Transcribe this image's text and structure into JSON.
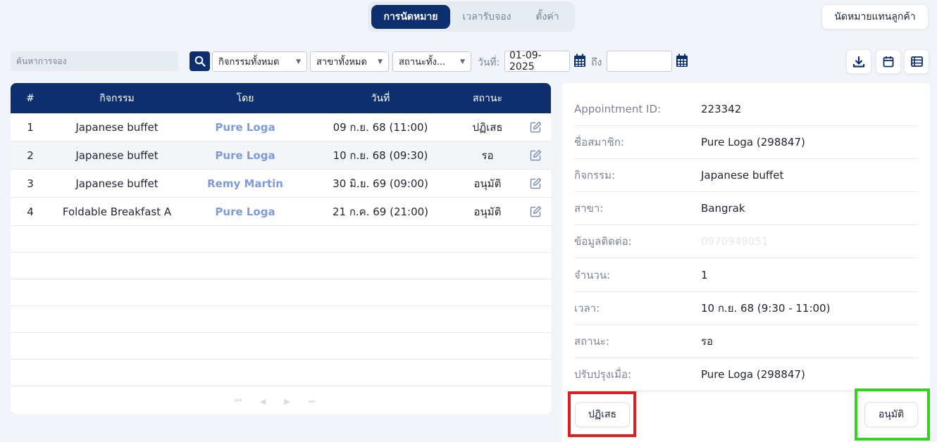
{
  "tabs": [
    {
      "label": "การนัดหมาย",
      "active": true
    },
    {
      "label": "เวลารับจอง",
      "active": false
    },
    {
      "label": "ตั้งค่า",
      "active": false
    }
  ],
  "proxy_button_label": "นัดหมายแทนลูกค้า",
  "filters": {
    "search_placeholder": "ค้นหาการจอง",
    "activity_select": "กิจกรรมทั้งหมด",
    "branch_select": "สาขาทั้งหมด",
    "status_select": "สถานะทั้ง...",
    "date_label": "วันที่:",
    "date_from": "01-09-2025",
    "to_label": "ถึง",
    "date_to": ""
  },
  "table": {
    "headers": [
      "#",
      "กิจกรรม",
      "โดย",
      "วันที่",
      "สถานะ"
    ],
    "rows": [
      {
        "idx": "1",
        "activity": "Japanese buffet",
        "by": "Pure Loga",
        "date": "09 ก.ย. 68 (11:00)",
        "status": "ปฏิเสธ"
      },
      {
        "idx": "2",
        "activity": "Japanese buffet",
        "by": "Pure Loga",
        "date": "10 ก.ย. 68 (09:30)",
        "status": "รอ"
      },
      {
        "idx": "3",
        "activity": "Japanese buffet",
        "by": "Remy Martin",
        "date": "30 มิ.ย. 69 (09:00)",
        "status": "อนุมัติ"
      },
      {
        "idx": "4",
        "activity": "Foldable Breakfast A",
        "by": "Pure Loga",
        "date": "21 ก.ค. 69 (21:00)",
        "status": "อนุมัติ"
      }
    ]
  },
  "detail": [
    {
      "label": "Appointment ID:",
      "value": "223342"
    },
    {
      "label": "ชื่อสมาชิก:",
      "value": "Pure Loga (298847)"
    },
    {
      "label": "กิจกรรม:",
      "value": "Japanese buffet"
    },
    {
      "label": "สาขา:",
      "value": "Bangrak"
    },
    {
      "label": "ข้อมูลติดต่อ:",
      "value": "0970949051"
    },
    {
      "label": "จำนวน:",
      "value": "1"
    },
    {
      "label": "เวลา:",
      "value": "10 ก.ย. 68 (9:30 - 11:00)"
    },
    {
      "label": "สถานะ:",
      "value": "รอ"
    },
    {
      "label": "ปรับปรุงเมื่อ:",
      "value": "Pure Loga (298847)"
    }
  ],
  "actions": {
    "reject_label": "ปฏิเสธ",
    "approve_label": "อนุมัติ"
  },
  "colors": {
    "primary": "#0d2f6e",
    "link": "#7d9ad9",
    "reject_highlight": "#e01e1e",
    "approve_highlight": "#35d11f"
  }
}
